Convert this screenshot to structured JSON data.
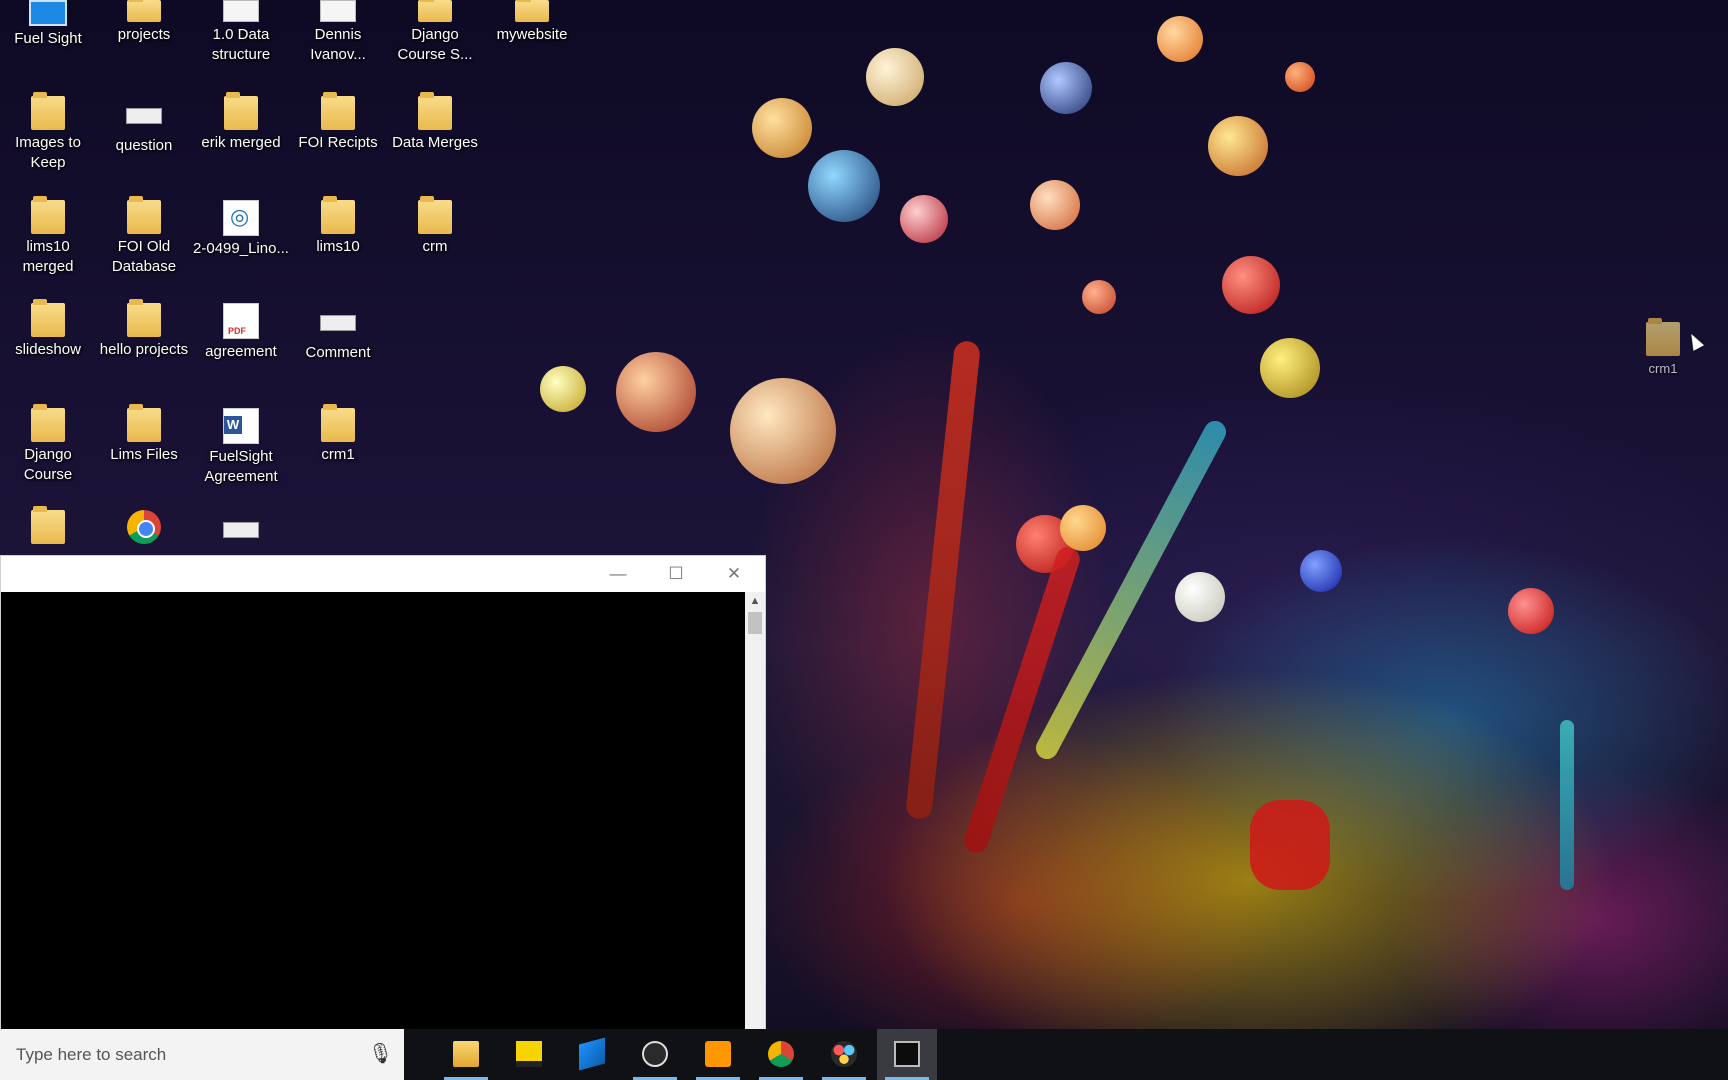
{
  "desktop": {
    "icons": [
      {
        "label": "Fuel Sight",
        "icon": "app-icon"
      },
      {
        "label": "projects",
        "icon": "folder-icon"
      },
      {
        "label": "1.0 Data structure",
        "icon": "document-icon"
      },
      {
        "label": "Dennis Ivanov...",
        "icon": "document-icon"
      },
      {
        "label": "Django Course S...",
        "icon": "folder-icon"
      },
      {
        "label": "mywebsite",
        "icon": "folder-icon"
      },
      {
        "label": "Images to Keep",
        "icon": "folder-icon"
      },
      {
        "label": "question",
        "icon": "card-icon"
      },
      {
        "label": "erik merged",
        "icon": "folder-icon"
      },
      {
        "label": "FOI Recipts",
        "icon": "folder-icon"
      },
      {
        "label": "Data Merges",
        "icon": "folder-icon"
      },
      {
        "label": "lims10 merged",
        "icon": "folder-icon"
      },
      {
        "label": "FOI Old Database",
        "icon": "zip-folder-icon"
      },
      {
        "label": "2-0499_Lino...",
        "icon": "target-file-icon"
      },
      {
        "label": "lims10",
        "icon": "zip-folder-icon"
      },
      {
        "label": "crm",
        "icon": "folder-icon"
      },
      {
        "label": "slideshow",
        "icon": "folder-icon"
      },
      {
        "label": "hello projects",
        "icon": "folder-icon"
      },
      {
        "label": "agreement",
        "icon": "pdf-icon"
      },
      {
        "label": "Comment",
        "icon": "card-icon"
      },
      {
        "label": "Django Course",
        "icon": "folder-icon"
      },
      {
        "label": "Lims Files",
        "icon": "folder-icon"
      },
      {
        "label": "FuelSight Agreement",
        "icon": "word-doc-icon"
      },
      {
        "label": "crm1",
        "icon": "folder-icon"
      },
      {
        "label": "",
        "icon": "folder-icon"
      },
      {
        "label": "",
        "icon": "chrome-icon"
      },
      {
        "label": "",
        "icon": "card-icon"
      },
      {
        "label": "crm1",
        "icon": "folder-icon"
      }
    ]
  },
  "window": {
    "minimize": "—",
    "maximize": "☐",
    "close": "✕",
    "scroll_up": "▲"
  },
  "taskbar": {
    "search_placeholder": "Type here to search",
    "mic": "🎙",
    "items": [
      {
        "name": "file-explorer",
        "running": true,
        "active": false
      },
      {
        "name": "sticky-notes",
        "running": false,
        "active": false
      },
      {
        "name": "remote-desktop",
        "running": false,
        "active": false
      },
      {
        "name": "obs-studio",
        "running": true,
        "active": false
      },
      {
        "name": "sublime-text",
        "running": true,
        "active": false
      },
      {
        "name": "chrome",
        "running": true,
        "active": false
      },
      {
        "name": "davinci-resolve",
        "running": true,
        "active": false
      },
      {
        "name": "command-prompt",
        "running": true,
        "active": true
      }
    ]
  },
  "colors": {
    "taskbar": "#101114",
    "accent": "#76b9ed",
    "console_bg": "#000000"
  }
}
